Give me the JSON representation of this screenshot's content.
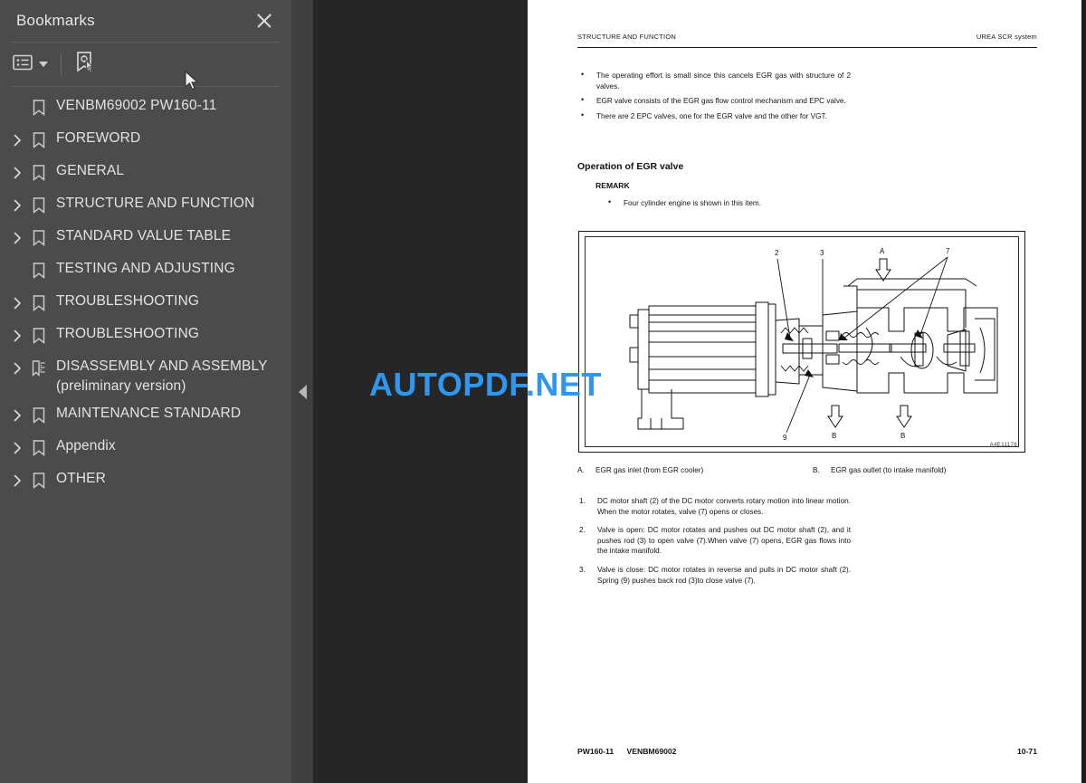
{
  "sidebar": {
    "title": "Bookmarks",
    "close_icon": "close-icon",
    "toolbar": {
      "options_icon": "list-options-icon",
      "caret_icon": "chevron-down-icon",
      "new_bookmark_icon": "new-bookmark-icon"
    },
    "items": [
      {
        "label": "VENBM69002 PW160-11",
        "expandable": false,
        "icon": "bookmark-icon"
      },
      {
        "label": "FOREWORD",
        "expandable": true,
        "icon": "bookmark-icon"
      },
      {
        "label": "GENERAL",
        "expandable": true,
        "icon": "bookmark-icon"
      },
      {
        "label": "STRUCTURE AND FUNCTION",
        "expandable": true,
        "icon": "bookmark-icon"
      },
      {
        "label": "STANDARD VALUE TABLE",
        "expandable": true,
        "icon": "bookmark-icon"
      },
      {
        "label": "TESTING AND ADJUSTING",
        "expandable": false,
        "icon": "bookmark-icon"
      },
      {
        "label": "TROUBLESHOOTING",
        "expandable": true,
        "icon": "bookmark-icon"
      },
      {
        "label": "TROUBLESHOOTING",
        "expandable": true,
        "icon": "bookmark-icon"
      },
      {
        "label": "DISASSEMBLY AND ASSEMBLY (preliminary version)",
        "expandable": true,
        "icon": "bookmark-tree-icon"
      },
      {
        "label": "MAINTENANCE STANDARD",
        "expandable": true,
        "icon": "bookmark-icon"
      },
      {
        "label": "Appendix",
        "expandable": true,
        "icon": "bookmark-icon"
      },
      {
        "label": "OTHER",
        "expandable": true,
        "icon": "bookmark-icon"
      }
    ]
  },
  "splitter": {
    "collapse_icon": "collapse-left-icon"
  },
  "watermark": {
    "text": "AUTOPDF.NET",
    "color": "#2f97f0"
  },
  "document": {
    "header": {
      "left": "STRUCTURE AND FUNCTION",
      "right": "UREA SCR system"
    },
    "bullets": [
      "The operating effort is small since this cancels EGR gas with structure of 2 valves.",
      "EGR valve consists of the EGR gas flow control mechanism and EPC valve.",
      "There are 2 EPC valves, one for the EGR valve and the other for VGT."
    ],
    "section_heading": "Operation of EGR valve",
    "remark_label": "REMARK",
    "remark_bullets": [
      "Four cylinder engine is shown in this item."
    ],
    "figure": {
      "code": "A4E11178",
      "callouts": [
        "2",
        "3",
        "7",
        "9"
      ],
      "flow_labels": [
        "A",
        "B",
        "B"
      ],
      "caption": "EGR valve cutaway with DC motor, rod, spring and valve"
    },
    "legend": [
      {
        "key": "A.",
        "text": "EGR gas inlet (from EGR cooler)"
      },
      {
        "key": "B.",
        "text": "EGR gas outlet (to intake manifold)"
      }
    ],
    "steps": [
      {
        "n": "1.",
        "text": "DC motor shaft (2) of the DC motor converts rotary motion into linear motion. When the motor rotates, valve (7) opens or closes."
      },
      {
        "n": "2.",
        "text": "Valve is open: DC motor rotates and pushes out DC motor shaft (2), and it pushes rod (3) to open valve (7).When valve (7) opens, EGR gas flows into the intake manifold."
      },
      {
        "n": "3.",
        "text": "Valve is close: DC motor rotates in reverse and pulls in DC motor shaft (2). Spring (9) pushes back rod (3)to close valve (7)."
      }
    ],
    "footer": {
      "model": "PW160-11",
      "doc_no": "VENBM69002",
      "page_no": "10-71"
    }
  }
}
